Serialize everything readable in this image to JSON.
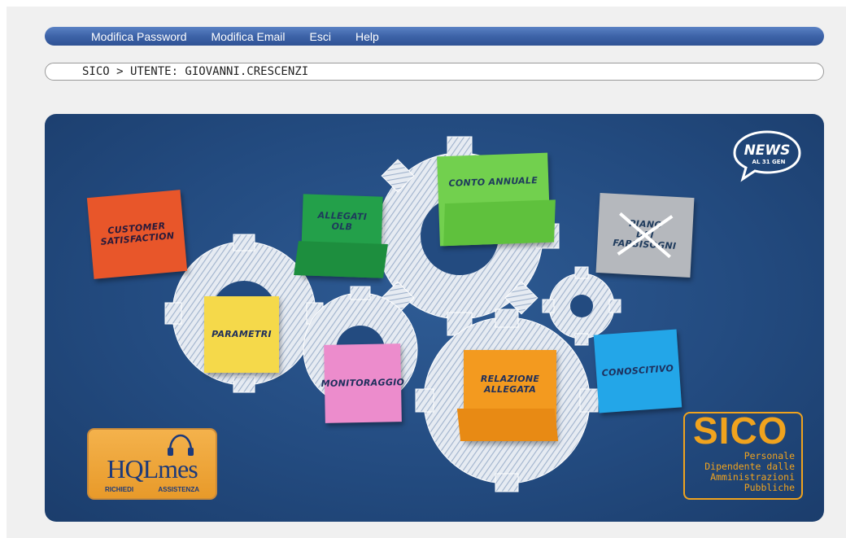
{
  "menu": {
    "items": [
      {
        "label": "Modifica Password"
      },
      {
        "label": "Modifica Email"
      },
      {
        "label": "Esci"
      },
      {
        "label": "Help"
      }
    ]
  },
  "breadcrumb": {
    "text": "SICO > UTENTE: GIOVANNI.CRESCENZI"
  },
  "tiles": {
    "customer": {
      "line1": "CUSTOMER",
      "line2": "SATISFACTION"
    },
    "allegati": {
      "line1": "ALLEGATI",
      "line2": "OLB"
    },
    "conto": {
      "label": "CONTO ANNUALE"
    },
    "piano": {
      "line1": "PIANO",
      "line2": "DEI",
      "line3": "FABBISOGNI"
    },
    "parametri": {
      "label": "PARAMETRI"
    },
    "monitoraggio": {
      "label": "MONITORAGGIO"
    },
    "relazione": {
      "line1": "RELAZIONE",
      "line2": "ALLEGATA"
    },
    "conoscitivo": {
      "label": "CONOSCITIVO"
    }
  },
  "news": {
    "title": "NEWS",
    "subtitle": "AL 31 GEN"
  },
  "hqlmes": {
    "name": "HQLmes",
    "sub_left": "RICHIEDI",
    "sub_right": "ASSISTENZA"
  },
  "sico_logo": {
    "title": "SICO",
    "lines": [
      "Personale",
      "Dipendente dalle",
      "Amministrazioni",
      "Pubbliche"
    ]
  },
  "colors": {
    "menubar": "#3d63a8",
    "panel": "#234b80",
    "customer": "#e8562a",
    "allegati": "#23a04a",
    "conto": "#72d04e",
    "piano": "#b5b8bd",
    "parametri": "#f5d94a",
    "monitoraggio": "#ec8ccc",
    "relazione": "#f39a1f",
    "conoscitivo": "#23a6e8",
    "sico_accent": "#f0a31e"
  }
}
